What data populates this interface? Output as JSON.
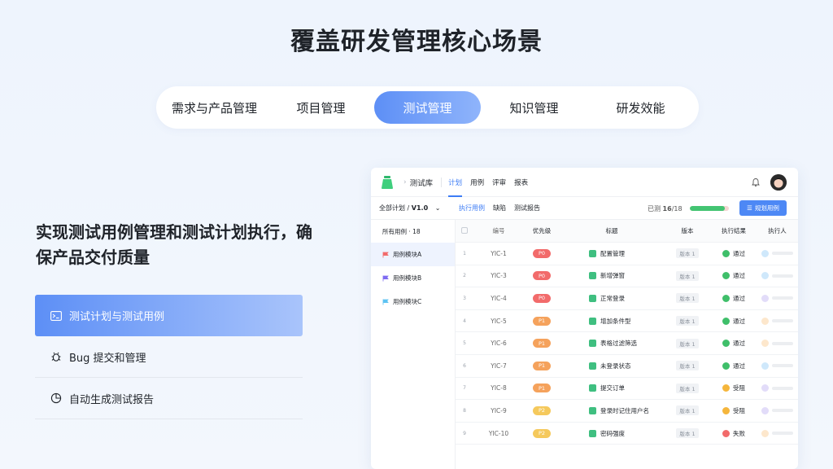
{
  "headline": "覆盖研发管理核心场景",
  "tabs": [
    {
      "label": "需求与产品管理",
      "active": false
    },
    {
      "label": "项目管理",
      "active": false
    },
    {
      "label": "测试管理",
      "active": true
    },
    {
      "label": "知识管理",
      "active": false
    },
    {
      "label": "研发效能",
      "active": false
    }
  ],
  "feature": {
    "title": "实现测试用例管理和测试计划执行，确保产品交付质量",
    "items": [
      {
        "label": "测试计划与测试用例",
        "icon": "terminal-icon",
        "active": true
      },
      {
        "label": "Bug 提交和管理",
        "icon": "bug-icon",
        "active": false
      },
      {
        "label": "自动生成测试报告",
        "icon": "pie-chart-icon",
        "active": false
      }
    ]
  },
  "app": {
    "breadcrumb": "测试库",
    "nav_tabs": [
      "计划",
      "用例",
      "评审",
      "报表"
    ],
    "active_nav": "计划",
    "plan_label": "全部计划 / ",
    "plan_version": "V1.0",
    "sub_tabs": [
      "执行用例",
      "缺陷",
      "测试报告"
    ],
    "progress_prefix": "已测 ",
    "progress_done": "16",
    "progress_total": "/18",
    "progress_fraction": 0.89,
    "plan_button": "规划用例",
    "all_cases": "所有用例 · 18",
    "modules": [
      {
        "label": "用例模块A",
        "color": "#f26b6b"
      },
      {
        "label": "用例模块B",
        "color": "#7e6bf2"
      },
      {
        "label": "用例模块C",
        "color": "#5ec3f2"
      }
    ],
    "columns": [
      "编号",
      "优先级",
      "标题",
      "版本",
      "执行结果",
      "执行人"
    ],
    "rows": [
      {
        "idx": "1",
        "no": "YIC-1",
        "pri": "P0",
        "title": "配置管理",
        "ver": "版本 1",
        "res": "通过",
        "res_color": "#3fbf6a",
        "exec_color": "#cfe8fb"
      },
      {
        "idx": "2",
        "no": "YIC-3",
        "pri": "P0",
        "title": "新增弹窗",
        "ver": "版本 1",
        "res": "通过",
        "res_color": "#3fbf6a",
        "exec_color": "#cfe8fb"
      },
      {
        "idx": "3",
        "no": "YIC-4",
        "pri": "P0",
        "title": "正常登录",
        "ver": "版本 1",
        "res": "通过",
        "res_color": "#3fbf6a",
        "exec_color": "#e2dcf9"
      },
      {
        "idx": "4",
        "no": "YIC-5",
        "pri": "P1",
        "title": "增加条件型",
        "ver": "版本 1",
        "res": "通过",
        "res_color": "#3fbf6a",
        "exec_color": "#fde7cc"
      },
      {
        "idx": "5",
        "no": "YIC-6",
        "pri": "P1",
        "title": "表格过滤筛选",
        "ver": "版本 1",
        "res": "通过",
        "res_color": "#3fbf6a",
        "exec_color": "#fde7cc"
      },
      {
        "idx": "6",
        "no": "YIC-7",
        "pri": "P1",
        "title": "未登录状态",
        "ver": "版本 1",
        "res": "通过",
        "res_color": "#3fbf6a",
        "exec_color": "#cfe8fb"
      },
      {
        "idx": "7",
        "no": "YIC-8",
        "pri": "P1",
        "title": "提交订单",
        "ver": "版本 1",
        "res": "受阻",
        "res_color": "#f5b63c",
        "exec_color": "#e2dcf9"
      },
      {
        "idx": "8",
        "no": "YIC-9",
        "pri": "P2",
        "title": "登录时记住用户名",
        "ver": "版本 1",
        "res": "受阻",
        "res_color": "#f5b63c",
        "exec_color": "#e2dcf9"
      },
      {
        "idx": "9",
        "no": "YIC-10",
        "pri": "P2",
        "title": "密码强度",
        "ver": "版本 1",
        "res": "失败",
        "res_color": "#f26b6b",
        "exec_color": "#fde7cc"
      }
    ],
    "pri_colors": {
      "P0": "#f26b6b",
      "P1": "#f5a25c",
      "P2": "#f5c95c"
    }
  }
}
